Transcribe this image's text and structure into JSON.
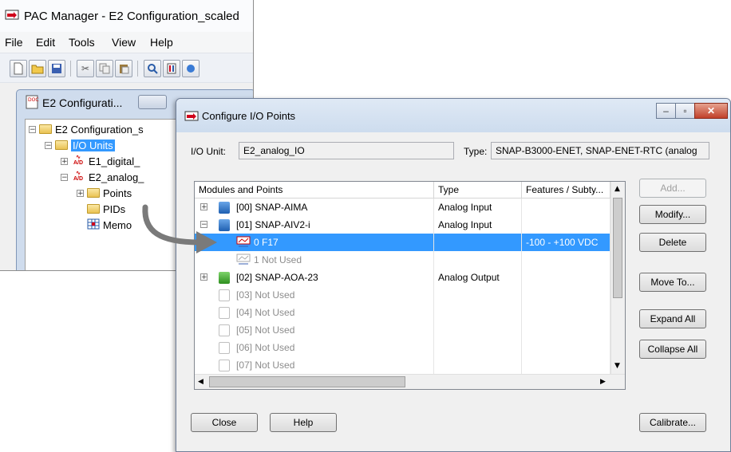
{
  "main_window": {
    "title": "PAC Manager - E2 Configuration_scaled",
    "menu": [
      "File",
      "Edit",
      "Tools",
      "View",
      "Help"
    ]
  },
  "child_window": {
    "title": "E2 Configurati...",
    "tree": {
      "root": "E2 Configuration_s",
      "io_units": "I/O Units",
      "unit1": "E1_digital_",
      "unit2": "E2_analog_",
      "points": "Points",
      "pids": "PIDs",
      "memo": "Memo"
    }
  },
  "dialog": {
    "title": "Configure I/O Points",
    "io_unit_label": "I/O Unit:",
    "io_unit_value": "E2_analog_IO",
    "type_label": "Type:",
    "type_value": "SNAP-B3000-ENET, SNAP-ENET-RTC  (analog",
    "columns": [
      "Modules and Points",
      "Type",
      "Features / Subty..."
    ],
    "rows": [
      {
        "expander": "+",
        "name": "[00] SNAP-AIMA",
        "type": "Analog Input",
        "features": "",
        "kind": "module-blue"
      },
      {
        "expander": "−",
        "name": "[01] SNAP-AIV2-i",
        "type": "Analog Input",
        "features": "",
        "kind": "module-blue"
      },
      {
        "expander": "",
        "name": "0  F17",
        "type": "",
        "features": "-100 - +100 VDC",
        "kind": "point-selected"
      },
      {
        "expander": "",
        "name": "1  Not Used",
        "type": "",
        "features": "",
        "kind": "point-disabled"
      },
      {
        "expander": "+",
        "name": "[02] SNAP-AOA-23",
        "type": "Analog Output",
        "features": "",
        "kind": "module-green"
      },
      {
        "expander": "",
        "name": "[03] Not Used",
        "type": "",
        "features": "",
        "kind": "empty"
      },
      {
        "expander": "",
        "name": "[04] Not Used",
        "type": "",
        "features": "",
        "kind": "empty"
      },
      {
        "expander": "",
        "name": "[05] Not Used",
        "type": "",
        "features": "",
        "kind": "empty"
      },
      {
        "expander": "",
        "name": "[06] Not Used",
        "type": "",
        "features": "",
        "kind": "empty"
      },
      {
        "expander": "",
        "name": "[07] Not Used",
        "type": "",
        "features": "",
        "kind": "empty"
      }
    ],
    "buttons": {
      "add": "Add...",
      "modify": "Modify...",
      "delete": "Delete",
      "move_to": "Move To...",
      "expand_all": "Expand All",
      "collapse_all": "Collapse All",
      "close": "Close",
      "help": "Help",
      "calibrate": "Calibrate..."
    }
  },
  "colors": {
    "selection": "#3399ff",
    "arrow": "#777777"
  }
}
